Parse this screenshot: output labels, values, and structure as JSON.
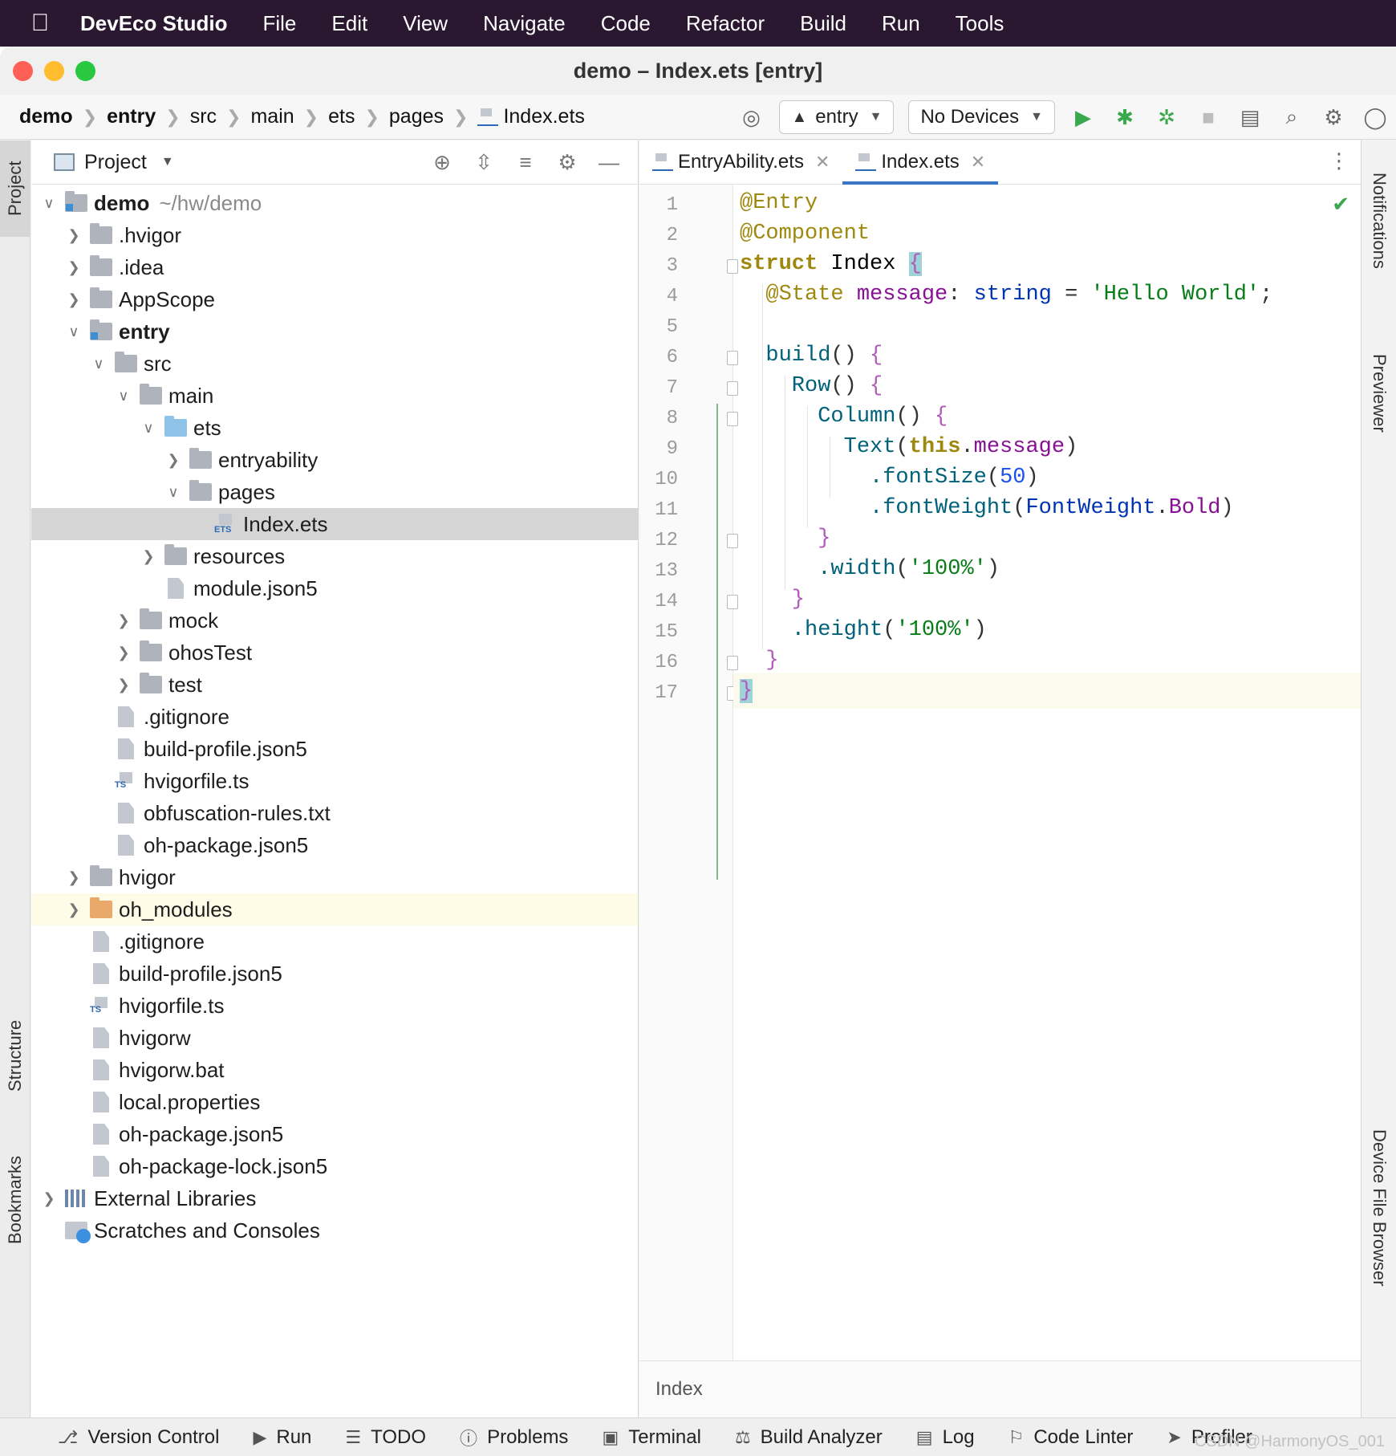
{
  "menubar": {
    "app_name": "DevEco Studio",
    "items": [
      "File",
      "Edit",
      "View",
      "Navigate",
      "Code",
      "Refactor",
      "Build",
      "Run",
      "Tools"
    ]
  },
  "window": {
    "title": "demo – Index.ets [entry]"
  },
  "navbar": {
    "breadcrumbs": [
      "demo",
      "entry",
      "src",
      "main",
      "ets",
      "pages",
      "Index.ets"
    ],
    "module_select": "entry",
    "device_select": "No Devices"
  },
  "left_strip": {
    "project_tab": "Project",
    "structure_tab": "Structure",
    "bookmarks_tab": "Bookmarks"
  },
  "right_strip": {
    "notifications_tab": "Notifications",
    "previewer_tab": "Previewer",
    "device_file_browser_tab": "Device File Browser"
  },
  "project_panel": {
    "header": "Project",
    "tree": [
      {
        "label": "demo",
        "hint": "~/hw/demo",
        "depth": 0,
        "arrow": "open",
        "icon": "module-folder",
        "bold": true
      },
      {
        "label": ".hvigor",
        "depth": 1,
        "arrow": "closed",
        "icon": "folder"
      },
      {
        "label": ".idea",
        "depth": 1,
        "arrow": "closed",
        "icon": "folder"
      },
      {
        "label": "AppScope",
        "depth": 1,
        "arrow": "closed",
        "icon": "folder"
      },
      {
        "label": "entry",
        "depth": 1,
        "arrow": "open",
        "icon": "module-folder",
        "bold": true
      },
      {
        "label": "src",
        "depth": 2,
        "arrow": "open",
        "icon": "folder"
      },
      {
        "label": "main",
        "depth": 3,
        "arrow": "open",
        "icon": "folder"
      },
      {
        "label": "ets",
        "depth": 4,
        "arrow": "open",
        "icon": "source-folder"
      },
      {
        "label": "entryability",
        "depth": 5,
        "arrow": "closed",
        "icon": "folder"
      },
      {
        "label": "pages",
        "depth": 5,
        "arrow": "open",
        "icon": "folder"
      },
      {
        "label": "Index.ets",
        "depth": 6,
        "arrow": "none",
        "icon": "ets-file",
        "selected": true
      },
      {
        "label": "resources",
        "depth": 4,
        "arrow": "closed",
        "icon": "folder"
      },
      {
        "label": "module.json5",
        "depth": 4,
        "arrow": "none",
        "icon": "json-file"
      },
      {
        "label": "mock",
        "depth": 3,
        "arrow": "closed",
        "icon": "folder"
      },
      {
        "label": "ohosTest",
        "depth": 3,
        "arrow": "closed",
        "icon": "folder"
      },
      {
        "label": "test",
        "depth": 3,
        "arrow": "closed",
        "icon": "folder"
      },
      {
        "label": ".gitignore",
        "depth": 2,
        "arrow": "none",
        "icon": "ignore-file"
      },
      {
        "label": "build-profile.json5",
        "depth": 2,
        "arrow": "none",
        "icon": "json-file"
      },
      {
        "label": "hvigorfile.ts",
        "depth": 2,
        "arrow": "none",
        "icon": "ts-file"
      },
      {
        "label": "obfuscation-rules.txt",
        "depth": 2,
        "arrow": "none",
        "icon": "text-file"
      },
      {
        "label": "oh-package.json5",
        "depth": 2,
        "arrow": "none",
        "icon": "json-file"
      },
      {
        "label": "hvigor",
        "depth": 1,
        "arrow": "closed",
        "icon": "folder"
      },
      {
        "label": "oh_modules",
        "depth": 1,
        "arrow": "closed",
        "icon": "excluded-folder",
        "highlight": true
      },
      {
        "label": ".gitignore",
        "depth": 1,
        "arrow": "none",
        "icon": "ignore-file"
      },
      {
        "label": "build-profile.json5",
        "depth": 1,
        "arrow": "none",
        "icon": "json-file"
      },
      {
        "label": "hvigorfile.ts",
        "depth": 1,
        "arrow": "none",
        "icon": "ts-file"
      },
      {
        "label": "hvigorw",
        "depth": 1,
        "arrow": "none",
        "icon": "script-file"
      },
      {
        "label": "hvigorw.bat",
        "depth": 1,
        "arrow": "none",
        "icon": "text-file"
      },
      {
        "label": "local.properties",
        "depth": 1,
        "arrow": "none",
        "icon": "properties-file"
      },
      {
        "label": "oh-package.json5",
        "depth": 1,
        "arrow": "none",
        "icon": "json-file"
      },
      {
        "label": "oh-package-lock.json5",
        "depth": 1,
        "arrow": "none",
        "icon": "json-file"
      },
      {
        "label": "External Libraries",
        "depth": 0,
        "arrow": "closed",
        "icon": "libraries"
      },
      {
        "label": "Scratches and Consoles",
        "depth": 0,
        "arrow": "none",
        "icon": "scratches"
      }
    ]
  },
  "editor": {
    "tabs": [
      {
        "label": "EntryAbility.ets",
        "active": false
      },
      {
        "label": "Index.ets",
        "active": true
      }
    ],
    "line_numbers": [
      "1",
      "2",
      "3",
      "4",
      "5",
      "6",
      "7",
      "8",
      "9",
      "10",
      "11",
      "12",
      "13",
      "14",
      "15",
      "16",
      "17"
    ],
    "code_lines": [
      [
        {
          "t": "@Entry",
          "c": "ann"
        }
      ],
      [
        {
          "t": "@Component",
          "c": "ann"
        }
      ],
      [
        {
          "t": "struct",
          "c": "kw2"
        },
        {
          "t": " Index ",
          "c": "name"
        },
        {
          "t": "{",
          "c": "brace",
          "hl": true
        }
      ],
      [
        {
          "t": "  @State",
          "c": "ann"
        },
        {
          "t": " message",
          "c": "fld"
        },
        {
          "t": ": ",
          "c": "pun"
        },
        {
          "t": "string",
          "c": "type"
        },
        {
          "t": " = ",
          "c": "pun"
        },
        {
          "t": "'Hello World'",
          "c": "str"
        },
        {
          "t": ";",
          "c": "pun"
        }
      ],
      [],
      [
        {
          "t": "  build",
          "c": "fn"
        },
        {
          "t": "() ",
          "c": "pun"
        },
        {
          "t": "{",
          "c": "brace"
        }
      ],
      [
        {
          "t": "    Row",
          "c": "fn"
        },
        {
          "t": "() ",
          "c": "pun"
        },
        {
          "t": "{",
          "c": "brace"
        }
      ],
      [
        {
          "t": "      Column",
          "c": "fn"
        },
        {
          "t": "() ",
          "c": "pun"
        },
        {
          "t": "{",
          "c": "brace"
        }
      ],
      [
        {
          "t": "        Text",
          "c": "fn"
        },
        {
          "t": "(",
          "c": "pun"
        },
        {
          "t": "this",
          "c": "kw2"
        },
        {
          "t": ".",
          "c": "pun"
        },
        {
          "t": "message",
          "c": "fld"
        },
        {
          "t": ")",
          "c": "pun"
        }
      ],
      [
        {
          "t": "          .fontSize",
          "c": "fn"
        },
        {
          "t": "(",
          "c": "pun"
        },
        {
          "t": "50",
          "c": "num"
        },
        {
          "t": ")",
          "c": "pun"
        }
      ],
      [
        {
          "t": "          .fontWeight",
          "c": "fn"
        },
        {
          "t": "(",
          "c": "pun"
        },
        {
          "t": "FontWeight",
          "c": "type"
        },
        {
          "t": ".",
          "c": "pun"
        },
        {
          "t": "Bold",
          "c": "fld"
        },
        {
          "t": ")",
          "c": "pun"
        }
      ],
      [
        {
          "t": "      }",
          "c": "brace"
        }
      ],
      [
        {
          "t": "      .width",
          "c": "fn"
        },
        {
          "t": "(",
          "c": "pun"
        },
        {
          "t": "'100%'",
          "c": "str"
        },
        {
          "t": ")",
          "c": "pun"
        }
      ],
      [
        {
          "t": "    }",
          "c": "brace"
        }
      ],
      [
        {
          "t": "    .height",
          "c": "fn"
        },
        {
          "t": "(",
          "c": "pun"
        },
        {
          "t": "'100%'",
          "c": "str"
        },
        {
          "t": ")",
          "c": "pun"
        }
      ],
      [
        {
          "t": "  }",
          "c": "brace"
        }
      ],
      [
        {
          "t": "}",
          "c": "brace",
          "hl": true
        }
      ]
    ],
    "current_line": 17,
    "status_text": "Index"
  },
  "bottom_bar": {
    "items": [
      {
        "label": "Version Control",
        "icon": "branch-icon"
      },
      {
        "label": "Run",
        "icon": "run-icon"
      },
      {
        "label": "TODO",
        "icon": "list-icon"
      },
      {
        "label": "Problems",
        "icon": "info-icon"
      },
      {
        "label": "Terminal",
        "icon": "terminal-icon"
      },
      {
        "label": "Build Analyzer",
        "icon": "analyzer-icon"
      },
      {
        "label": "Log",
        "icon": "log-icon"
      },
      {
        "label": "Code Linter",
        "icon": "linter-icon"
      },
      {
        "label": "Profiler",
        "icon": "profiler-icon"
      }
    ],
    "watermark": "CSDN @HarmonyOS_001"
  }
}
